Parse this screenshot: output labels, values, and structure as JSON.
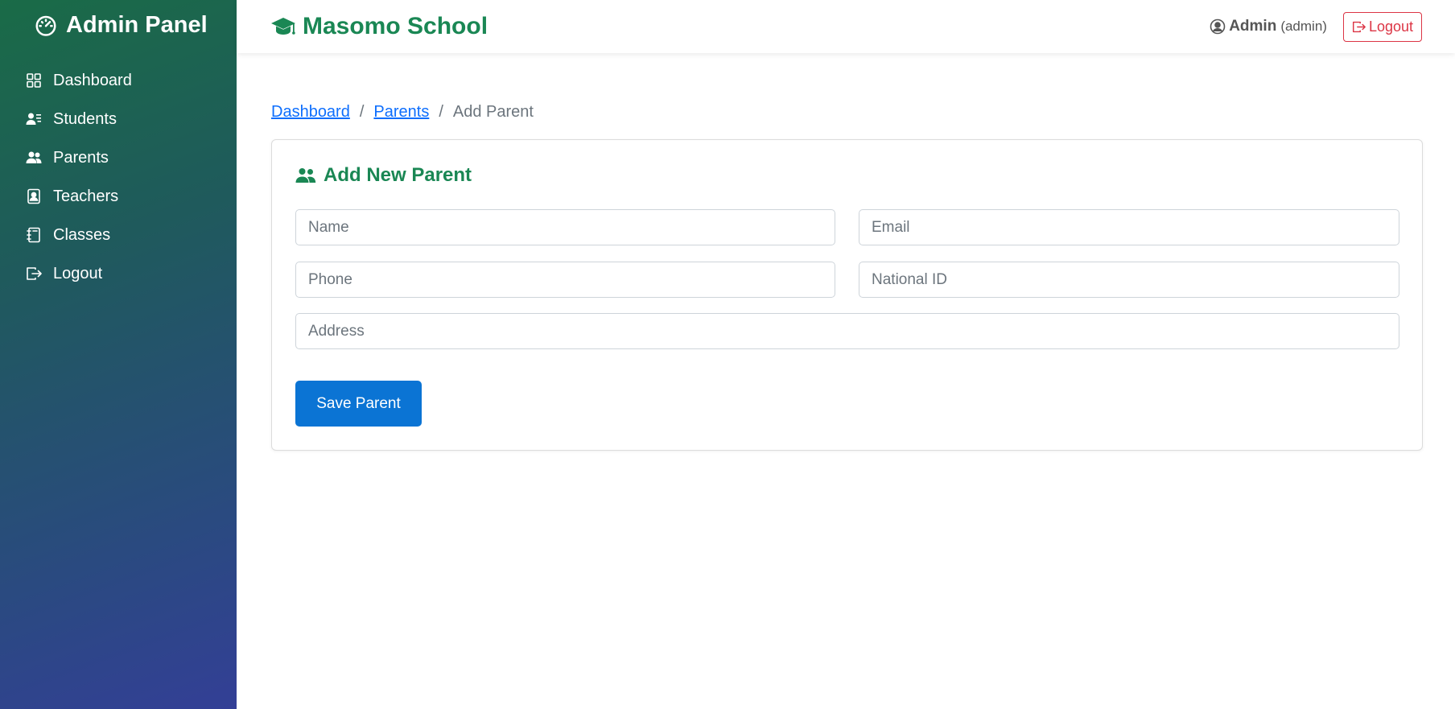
{
  "sidebar": {
    "brand": "Admin Panel",
    "brand_icon": "speedometer-icon",
    "items": [
      {
        "label": "Dashboard",
        "icon": "grid-icon"
      },
      {
        "label": "Students",
        "icon": "person-lines-icon"
      },
      {
        "label": "Parents",
        "icon": "people-icon"
      },
      {
        "label": "Teachers",
        "icon": "person-badge-icon"
      },
      {
        "label": "Classes",
        "icon": "journal-icon"
      },
      {
        "label": "Logout",
        "icon": "box-arrow-right-icon"
      }
    ]
  },
  "header": {
    "school_name": "Masomo School",
    "school_icon": "mortarboard-icon",
    "user_name": "Admin",
    "user_role": "(admin)",
    "logout_label": "Logout"
  },
  "breadcrumb": {
    "items": [
      "Dashboard",
      "Parents"
    ],
    "separator": "/",
    "current": "Add Parent"
  },
  "form": {
    "title": "Add New Parent",
    "fields": {
      "name": {
        "placeholder": "Name",
        "value": ""
      },
      "email": {
        "placeholder": "Email",
        "value": ""
      },
      "phone": {
        "placeholder": "Phone",
        "value": ""
      },
      "national_id": {
        "placeholder": "National ID",
        "value": ""
      },
      "address": {
        "placeholder": "Address",
        "value": ""
      }
    },
    "submit_label": "Save Parent"
  },
  "colors": {
    "brand_green": "#1a8754",
    "primary_blue": "#0b74d4",
    "danger_red": "#dc3545",
    "link_blue": "#0d6efd"
  }
}
